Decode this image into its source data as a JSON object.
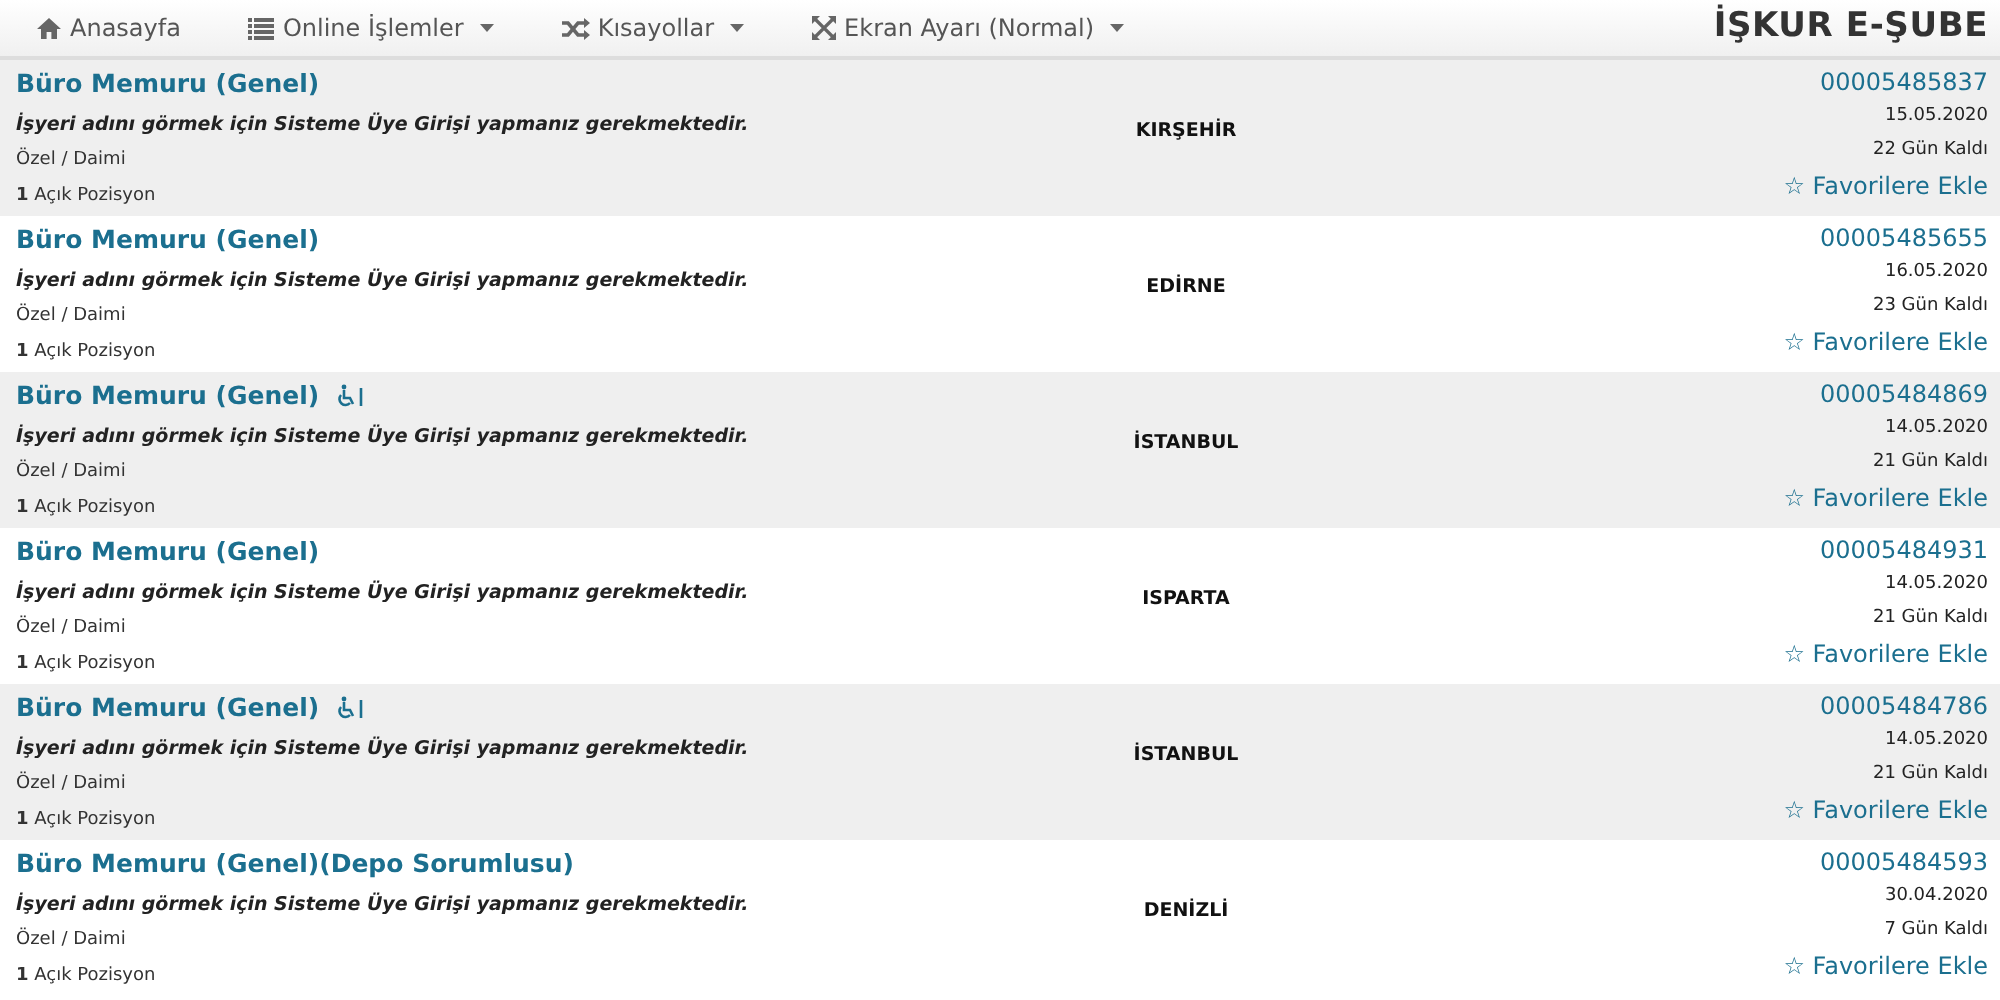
{
  "nav": {
    "items": [
      {
        "label": "Anasayfa",
        "dropdown": false
      },
      {
        "label": "Online İşlemler",
        "dropdown": true
      },
      {
        "label": "Kısayollar",
        "dropdown": true
      },
      {
        "label": "Ekran Ayarı (Normal)",
        "dropdown": true
      }
    ],
    "brand": "İŞKUR E-ŞUBE"
  },
  "listings": [
    {
      "title": "Büro Memuru (Genel)",
      "accessible": false,
      "note": "İşyeri adını görmek için Sisteme Üye Girişi yapmanız gerekmektedir.",
      "type": "Özel / Daimi",
      "positions": "**1** Açık Pozisyon",
      "city": "KIRŞEHİR",
      "number": "00005485837",
      "date": "15.05.2020",
      "remaining": "22 Gün Kaldı",
      "favorite": "☆ Favorilere Ekle"
    },
    {
      "title": "Büro Memuru (Genel)",
      "accessible": false,
      "note": "İşyeri adını görmek için Sisteme Üye Girişi yapmanız gerekmektedir.",
      "type": "Özel / Daimi",
      "positions": "**1** Açık Pozisyon",
      "city": "EDİRNE",
      "number": "00005485655",
      "date": "16.05.2020",
      "remaining": "23 Gün Kaldı",
      "favorite": "☆ Favorilere Ekle"
    },
    {
      "title": "Büro Memuru (Genel)",
      "accessible": true,
      "note": "İşyeri adını görmek için Sisteme Üye Girişi yapmanız gerekmektedir.",
      "type": "Özel / Daimi",
      "positions": "**1** Açık Pozisyon",
      "city": "İSTANBUL",
      "number": "00005484869",
      "date": "14.05.2020",
      "remaining": "21 Gün Kaldı",
      "favorite": "☆ Favorilere Ekle"
    },
    {
      "title": "Büro Memuru (Genel)",
      "accessible": false,
      "note": "İşyeri adını görmek için Sisteme Üye Girişi yapmanız gerekmektedir.",
      "type": "Özel / Daimi",
      "positions": "**1** Açık Pozisyon",
      "city": "ISPARTA",
      "number": "00005484931",
      "date": "14.05.2020",
      "remaining": "21 Gün Kaldı",
      "favorite": "☆ Favorilere Ekle"
    },
    {
      "title": "Büro Memuru (Genel)",
      "accessible": true,
      "note": "İşyeri adını görmek için Sisteme Üye Girişi yapmanız gerekmektedir.",
      "type": "Özel / Daimi",
      "positions": "**1** Açık Pozisyon",
      "city": "İSTANBUL",
      "number": "00005484786",
      "date": "14.05.2020",
      "remaining": "21 Gün Kaldı",
      "favorite": "☆ Favorilere Ekle"
    },
    {
      "title": "Büro Memuru (Genel)(Depo Sorumlusu)",
      "accessible": false,
      "note": "İşyeri adını görmek için Sisteme Üye Girişi yapmanız gerekmektedir.",
      "type": "Özel / Daimi",
      "positions": "**1** Açık Pozisyon",
      "city": "DENİZLİ",
      "number": "00005484593",
      "date": "30.04.2020",
      "remaining": "7 Gün Kaldı",
      "favorite": "☆ Favorilere Ekle"
    }
  ]
}
